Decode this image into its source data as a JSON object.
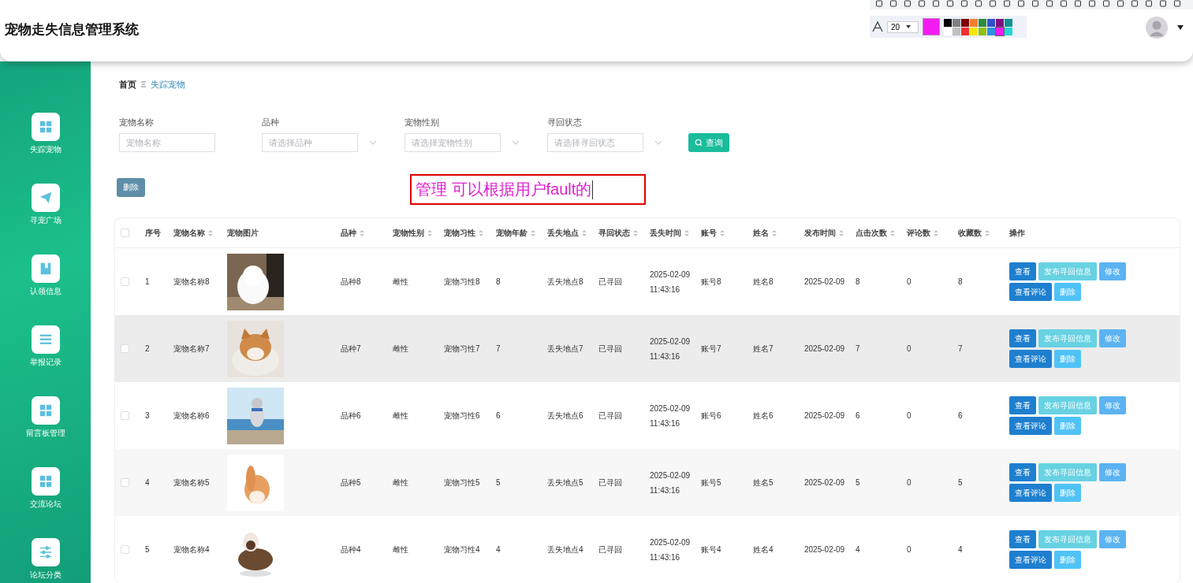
{
  "header": {
    "title": "宠物走失信息管理系统"
  },
  "annotation_toolbar": {
    "font_size": "20",
    "palette": [
      {
        "color": "#000000",
        "selected": false
      },
      {
        "color": "#808080",
        "selected": false
      },
      {
        "color": "#800000",
        "selected": false
      },
      {
        "color": "#f08030",
        "selected": false
      },
      {
        "color": "#2e8b3e",
        "selected": false
      },
      {
        "color": "#3050d0",
        "selected": false
      },
      {
        "color": "#801080",
        "selected": false
      },
      {
        "color": "#109090",
        "selected": false
      },
      {
        "color": "#ffffff",
        "selected": false
      },
      {
        "color": "#c0c0c0",
        "selected": false
      },
      {
        "color": "#f03030",
        "selected": false
      },
      {
        "color": "#f8e800",
        "selected": false
      },
      {
        "color": "#90c010",
        "selected": false
      },
      {
        "color": "#3090e0",
        "selected": false
      },
      {
        "color": "#f21cf2",
        "selected": true
      },
      {
        "color": "#20d8d8",
        "selected": false
      }
    ]
  },
  "sidebar": {
    "items": [
      {
        "label": "失踪宠物",
        "kind": "grid"
      },
      {
        "label": "寻宠广场",
        "kind": "plane"
      },
      {
        "label": "认领信息",
        "kind": "book"
      },
      {
        "label": "举报记录",
        "kind": "list"
      },
      {
        "label": "留言板管理",
        "kind": "grid"
      },
      {
        "label": "交流论坛",
        "kind": "grid"
      },
      {
        "label": "论坛分类",
        "kind": "sliders"
      }
    ]
  },
  "breadcrumb": [
    {
      "label": "首页",
      "selected": false
    },
    {
      "label": "失踪宠物",
      "selected": true
    }
  ],
  "filters": [
    {
      "label": "宠物名称",
      "placeholder": "宠物名称",
      "kind": "input"
    },
    {
      "label": "品种",
      "placeholder": "请选择品种",
      "kind": "select"
    },
    {
      "label": "宠物性别",
      "placeholder": "请选择宠物性别",
      "kind": "select"
    },
    {
      "label": "寻回状态",
      "placeholder": "请选择寻回状态",
      "kind": "select"
    }
  ],
  "query_button": "查询",
  "delete_button": "删除",
  "annotation_text": "管理 可以根据用户fault的",
  "table": {
    "all_checked": false,
    "columns": [
      {
        "label": "序号",
        "sortable": false
      },
      {
        "label": "宠物名称",
        "sortable": true
      },
      {
        "label": "宠物图片",
        "sortable": false
      },
      {
        "label": "品种",
        "sortable": true
      },
      {
        "label": "宠物性别",
        "sortable": true
      },
      {
        "label": "宠物习性",
        "sortable": true
      },
      {
        "label": "宠物年龄",
        "sortable": true
      },
      {
        "label": "丢失地点",
        "sortable": true
      },
      {
        "label": "寻回状态",
        "sortable": true
      },
      {
        "label": "丢失时间",
        "sortable": true
      },
      {
        "label": "账号",
        "sortable": true
      },
      {
        "label": "姓名",
        "sortable": true
      },
      {
        "label": "发布时间",
        "sortable": true
      },
      {
        "label": "点击次数",
        "sortable": true
      },
      {
        "label": "评论数",
        "sortable": true
      },
      {
        "label": "收藏数",
        "sortable": true
      },
      {
        "label": "操作",
        "sortable": false
      }
    ],
    "rows": [
      {
        "checked": false,
        "cells": [
          "1",
          "宠物名称8",
          {
            "kind": "picture"
          },
          "品种8",
          "雌性",
          "宠物习性8",
          "8",
          "丢失地点8",
          "已寻回",
          "2025-02-09 11:43:16",
          "账号8",
          "姓名8",
          "2025-02-09",
          "8",
          "0",
          "8"
        ],
        "actions": [
          {
            "label": "查看",
            "kind": "primary"
          },
          {
            "label": "发布寻回信息",
            "kind": "cyan"
          },
          {
            "label": "修改",
            "kind": "light"
          },
          {
            "label": "查看评论",
            "kind": "primary"
          },
          {
            "label": "删除",
            "kind": "sky"
          }
        ]
      },
      {
        "checked": false,
        "cells": [
          "2",
          "宠物名称7",
          {
            "kind": "picture"
          },
          "品种7",
          "雌性",
          "宠物习性7",
          "7",
          "丢失地点7",
          "已寻回",
          "2025-02-09 11:43:16",
          "账号7",
          "姓名7",
          "2025-02-09",
          "7",
          "0",
          "7"
        ],
        "actions": [
          {
            "label": "查看",
            "kind": "primary"
          },
          {
            "label": "发布寻回信息",
            "kind": "cyan"
          },
          {
            "label": "修改",
            "kind": "light"
          },
          {
            "label": "查看评论",
            "kind": "primary"
          },
          {
            "label": "删除",
            "kind": "sky"
          }
        ]
      },
      {
        "checked": false,
        "cells": [
          "3",
          "宠物名称6",
          {
            "kind": "picture"
          },
          "品种6",
          "雌性",
          "宠物习性6",
          "6",
          "丢失地点6",
          "已寻回",
          "2025-02-09 11:43:16",
          "账号6",
          "姓名6",
          "2025-02-09",
          "6",
          "0",
          "6"
        ],
        "actions": [
          {
            "label": "查看",
            "kind": "primary"
          },
          {
            "label": "发布寻回信息",
            "kind": "cyan"
          },
          {
            "label": "修改",
            "kind": "light"
          },
          {
            "label": "查看评论",
            "kind": "primary"
          },
          {
            "label": "删除",
            "kind": "sky"
          }
        ]
      },
      {
        "checked": false,
        "cells": [
          "4",
          "宠物名称5",
          {
            "kind": "picture"
          },
          "品种5",
          "雌性",
          "宠物习性5",
          "5",
          "丢失地点5",
          "已寻回",
          "2025-02-09 11:43:16",
          "账号5",
          "姓名5",
          "2025-02-09",
          "5",
          "0",
          "5"
        ],
        "actions": [
          {
            "label": "查看",
            "kind": "primary"
          },
          {
            "label": "发布寻回信息",
            "kind": "cyan"
          },
          {
            "label": "修改",
            "kind": "light"
          },
          {
            "label": "查看评论",
            "kind": "primary"
          },
          {
            "label": "删除",
            "kind": "sky"
          }
        ]
      },
      {
        "checked": false,
        "cells": [
          "5",
          "宠物名称4",
          {
            "kind": "picture"
          },
          "品种4",
          "雌性",
          "宠物习性4",
          "4",
          "丢失地点4",
          "已寻回",
          "2025-02-09 11:43:16",
          "账号4",
          "姓名4",
          "2025-02-09",
          "4",
          "0",
          "4"
        ],
        "actions": [
          {
            "label": "查看",
            "kind": "primary"
          },
          {
            "label": "发布寻回信息",
            "kind": "cyan"
          },
          {
            "label": "修改",
            "kind": "light"
          },
          {
            "label": "查看评论",
            "kind": "primary"
          },
          {
            "label": "删除",
            "kind": "sky"
          }
        ]
      }
    ]
  }
}
